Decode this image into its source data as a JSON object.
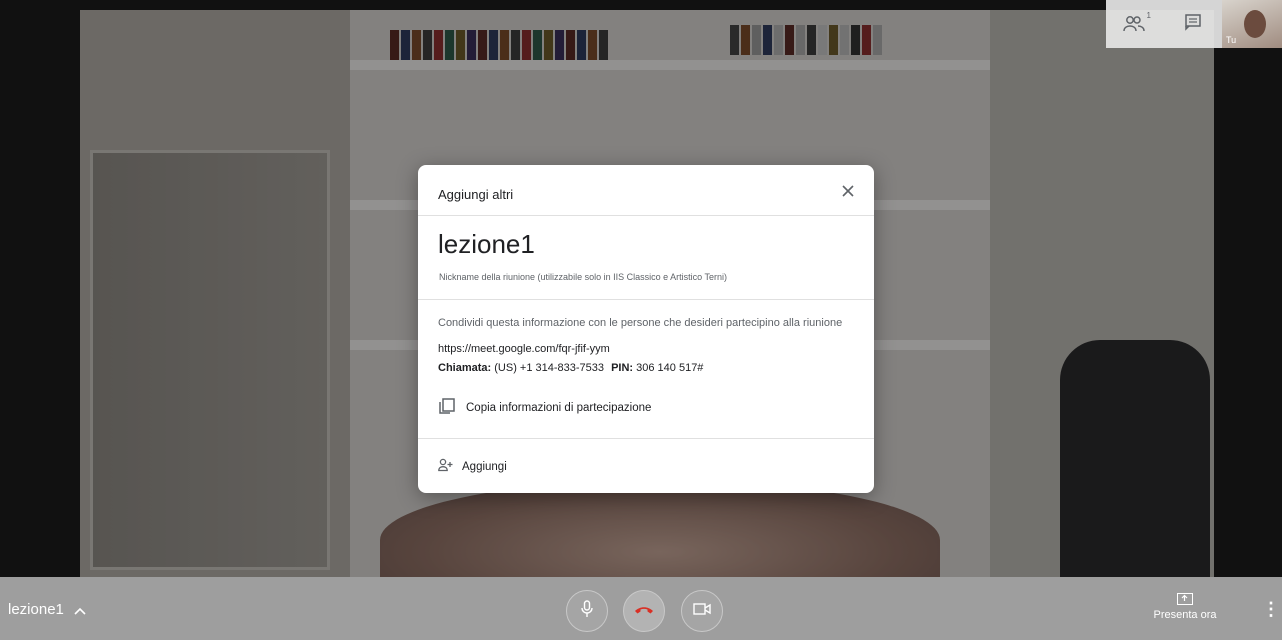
{
  "dialog": {
    "title": "Aggiungi altri",
    "nickname": "lezione1",
    "nickname_note": "Nickname della riunione (utilizzabile solo in IIS Classico e Artistico Terni)",
    "share_text": "Condividi questa informazione con le persone che desideri partecipino alla riunione",
    "meeting_url": "https://meet.google.com/fqr-jfif-yym",
    "phone_label": "Chiamata:",
    "phone_number": "(US) +1 314-833-7533",
    "pin_label": "PIN:",
    "pin_value": "306 140 517#",
    "copy_label": "Copia informazioni di partecipazione",
    "add_label": "Aggiungi"
  },
  "topbar": {
    "participants_count": "1",
    "self_label": "Tu"
  },
  "bottombar": {
    "meeting_name": "lezione1",
    "present_label": "Presenta ora"
  },
  "colors": {
    "hangup": "#d93025",
    "text_primary": "#202124",
    "text_secondary": "#5f6368"
  },
  "icons": [
    "people-icon",
    "chat-icon",
    "close-icon",
    "copy-icon",
    "add-person-icon",
    "mic-icon",
    "hangup-icon",
    "camera-icon",
    "present-icon",
    "more-vert-icon",
    "chevron-up-icon"
  ]
}
